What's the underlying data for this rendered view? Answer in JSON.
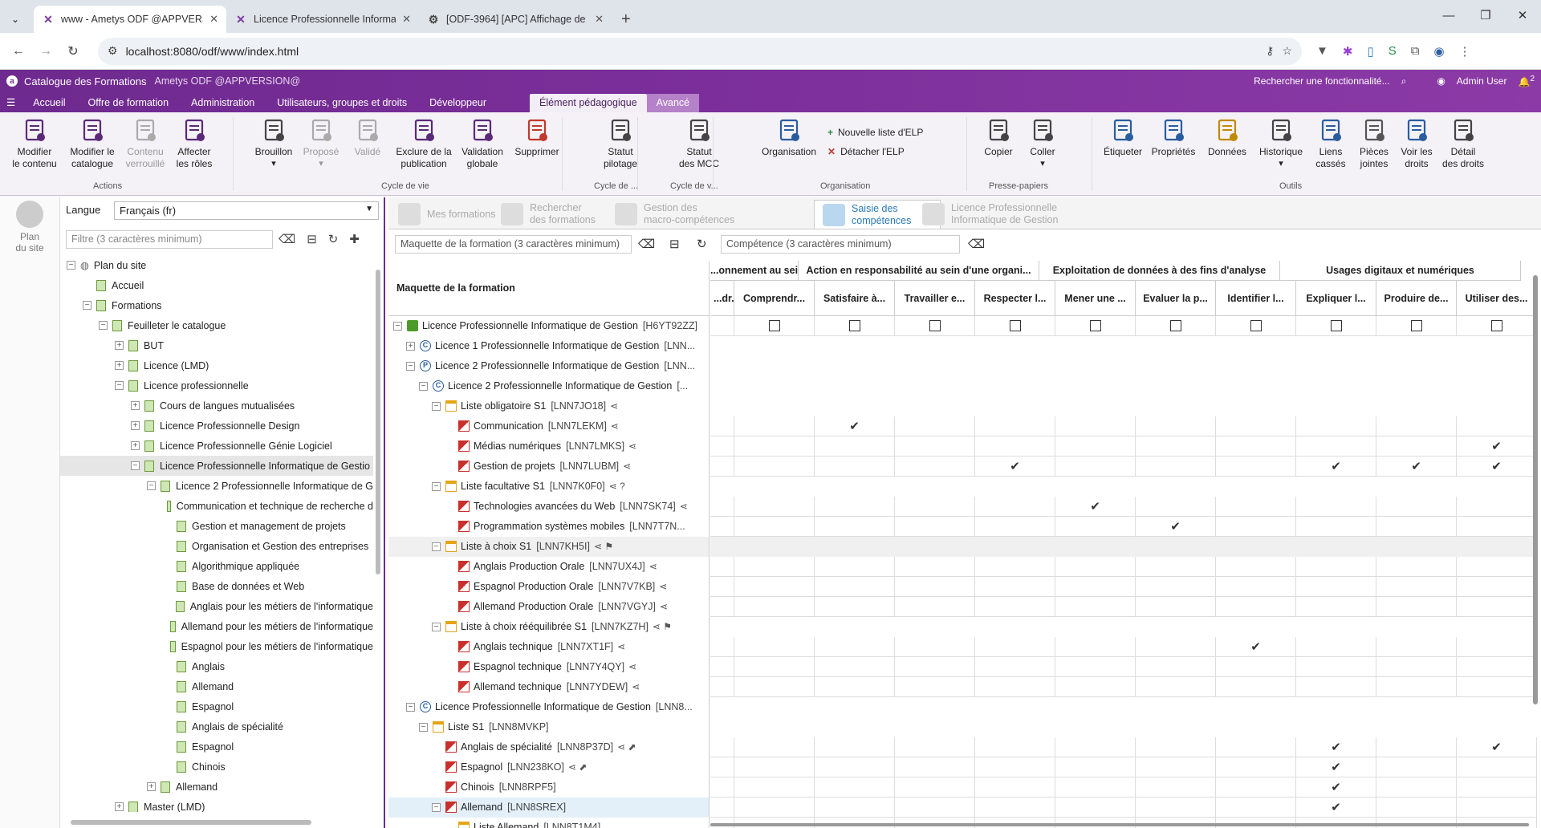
{
  "browser": {
    "tabs": [
      {
        "title": "www - Ametys ODF @APPVERSI",
        "icon": "ametys-icon"
      },
      {
        "title": "Licence Professionnelle Informa",
        "icon": "ametys-icon"
      },
      {
        "title": "[ODF-3964] [APC] Affichage de",
        "icon": "jira-icon"
      }
    ],
    "url": "localhost:8080/odf/www/index.html"
  },
  "app": {
    "title": "Catalogue des Formations",
    "version": "Ametys ODF @APPVERSION@",
    "search_placeholder": "Rechercher une fonctionnalité...",
    "user": "Admin User",
    "notif_count": "2",
    "menu": [
      "Accueil",
      "Offre de formation",
      "Administration",
      "Utilisateurs, groupes et droits",
      "Développeur"
    ],
    "context_tabs": [
      "Élément pédagogique",
      "Avancé"
    ]
  },
  "ribbon": {
    "buttons": [
      {
        "label1": "Modifier",
        "label2": "le contenu",
        "icon": "edit-icon"
      },
      {
        "label1": "Modifier le",
        "label2": "catalogue",
        "icon": "catalog-edit-icon"
      },
      {
        "label1": "Contenu",
        "label2": "verrouillé",
        "icon": "lock-icon"
      },
      {
        "label1": "Affecter",
        "label2": "les rôles",
        "icon": "roles-icon"
      },
      {
        "label1": "Brouillon",
        "label2": "",
        "icon": "draft-icon"
      },
      {
        "label1": "Proposé",
        "label2": "",
        "icon": "proposed-icon"
      },
      {
        "label1": "Validé",
        "label2": "",
        "icon": "validated-icon"
      },
      {
        "label1": "Exclure de la",
        "label2": "publication",
        "icon": "eye-icon"
      },
      {
        "label1": "Validation",
        "label2": "globale",
        "icon": "global-validation-icon"
      },
      {
        "label1": "Supprimer",
        "label2": "",
        "icon": "delete-icon"
      },
      {
        "label1": "Statut",
        "label2": "pilotage",
        "icon": "pilotage-icon"
      },
      {
        "label1": "Statut",
        "label2": "des MCC",
        "icon": "mcc-icon"
      },
      {
        "label1": "Organisation",
        "label2": "",
        "icon": "organisation-icon"
      },
      {
        "label1": "Copier",
        "label2": "",
        "icon": "copy-icon"
      },
      {
        "label1": "Coller",
        "label2": "",
        "icon": "paste-icon"
      },
      {
        "label1": "Étiqueter",
        "label2": "",
        "icon": "tag-icon"
      },
      {
        "label1": "Propriétés",
        "label2": "",
        "icon": "properties-icon"
      },
      {
        "label1": "Données",
        "label2": "",
        "icon": "data-icon"
      },
      {
        "label1": "Historique",
        "label2": "",
        "icon": "history-icon"
      },
      {
        "label1": "Liens",
        "label2": "cassés",
        "icon": "broken-links-icon"
      },
      {
        "label1": "Pièces",
        "label2": "jointes",
        "icon": "attachment-icon"
      },
      {
        "label1": "Voir les",
        "label2": "droits",
        "icon": "rights-icon"
      },
      {
        "label1": "Détail",
        "label2": "des droits",
        "icon": "rights-detail-icon"
      }
    ],
    "small": [
      "Nouvelle liste d'ELP",
      "Détacher l'ELP"
    ],
    "groups": [
      "Actions",
      "Cycle de vie",
      "Cycle de ...",
      "Cycle de v...",
      "Organisation",
      "Presse-papiers",
      "Outils"
    ]
  },
  "left": {
    "side_label1": "Plan",
    "side_label2": "du site",
    "lang_label": "Langue",
    "lang_value": "Français (fr)",
    "filter_placeholder": "Filtre (3 caractères minimum)",
    "tree": [
      {
        "t": "Plan du site",
        "d": 0,
        "e": "-",
        "k": "globe"
      },
      {
        "t": "Accueil",
        "d": 1,
        "e": "",
        "k": "page"
      },
      {
        "t": "Formations",
        "d": 1,
        "e": "-",
        "k": "page"
      },
      {
        "t": "Feuilleter le catalogue",
        "d": 2,
        "e": "-",
        "k": "page"
      },
      {
        "t": "BUT",
        "d": 3,
        "e": "+",
        "k": "page"
      },
      {
        "t": "Licence (LMD)",
        "d": 3,
        "e": "+",
        "k": "page"
      },
      {
        "t": "Licence professionnelle",
        "d": 3,
        "e": "-",
        "k": "page"
      },
      {
        "t": "Cours de langues mutualisées",
        "d": 4,
        "e": "+",
        "k": "page"
      },
      {
        "t": "Licence Professionnelle Design",
        "d": 4,
        "e": "+",
        "k": "page"
      },
      {
        "t": "Licence Professionnelle Génie Logiciel",
        "d": 4,
        "e": "+",
        "k": "page"
      },
      {
        "t": "Licence Professionnelle Informatique de Gestio",
        "d": 4,
        "e": "-",
        "k": "page",
        "sel": true
      },
      {
        "t": "Licence 2 Professionnelle Informatique de G",
        "d": 5,
        "e": "-",
        "k": "page"
      },
      {
        "t": "Communication et technique de recherche d",
        "d": 6,
        "e": "",
        "k": "page"
      },
      {
        "t": "Gestion et management de projets",
        "d": 6,
        "e": "",
        "k": "page"
      },
      {
        "t": "Organisation et Gestion des entreprises",
        "d": 6,
        "e": "",
        "k": "page"
      },
      {
        "t": "Algorithmique appliquée",
        "d": 6,
        "e": "",
        "k": "page"
      },
      {
        "t": "Base de données et Web",
        "d": 6,
        "e": "",
        "k": "page"
      },
      {
        "t": "Anglais pour les métiers de l'informatique",
        "d": 6,
        "e": "",
        "k": "page"
      },
      {
        "t": "Allemand pour les métiers de l'informatique",
        "d": 6,
        "e": "",
        "k": "page"
      },
      {
        "t": "Espagnol pour les métiers de l'informatique",
        "d": 6,
        "e": "",
        "k": "page"
      },
      {
        "t": "Anglais",
        "d": 6,
        "e": "",
        "k": "page"
      },
      {
        "t": "Allemand",
        "d": 6,
        "e": "",
        "k": "page"
      },
      {
        "t": "Espagnol",
        "d": 6,
        "e": "",
        "k": "page"
      },
      {
        "t": "Anglais de spécialité",
        "d": 6,
        "e": "",
        "k": "page"
      },
      {
        "t": "Espagnol",
        "d": 6,
        "e": "",
        "k": "page"
      },
      {
        "t": "Chinois",
        "d": 6,
        "e": "",
        "k": "page"
      },
      {
        "t": "Allemand",
        "d": 5,
        "e": "+",
        "k": "page"
      },
      {
        "t": "Master (LMD)",
        "d": 3,
        "e": "+",
        "k": "page"
      }
    ]
  },
  "right": {
    "tabs": [
      "Mes formations",
      "Rechercher des formations",
      "Gestion des macro-compétences",
      "Saisie des compétences",
      "Licence Professionnelle Informatique de Gestion"
    ],
    "tab_lines": [
      [
        "Mes formations"
      ],
      [
        "Rechercher",
        "des formations"
      ],
      [
        "Gestion des",
        "macro-compétences"
      ],
      [
        "Saisie des",
        "compétences"
      ],
      [
        "Licence Professionnelle",
        "Informatique de Gestion"
      ]
    ],
    "filter1_placeholder": "Maquette de la formation (3 caractères minimum)",
    "filter2_placeholder": "Compétence (3 caractères minimum)",
    "tree_header": "Maquette de la formation",
    "groups": [
      {
        "label": "...onnement au sein ...",
        "span": 2
      },
      {
        "label": "Action en responsabilité au sein d'une organi...",
        "span": 3
      },
      {
        "label": "Exploitation de données à des fins d'analyse",
        "span": 3
      },
      {
        "label": "Usages digitaux et numériques",
        "span": 3
      }
    ],
    "columns": [
      "...dr...",
      "Comprendr...",
      "Satisfaire à...",
      "Travailler e...",
      "Respecter l...",
      "Mener une ...",
      "Evaluer la p...",
      "Identifier l...",
      "Expliquer l...",
      "Produire de...",
      "Utiliser des..."
    ],
    "rows": [
      {
        "t": "Licence Professionnelle Informatique de Gestion",
        "c": "[H6YT92ZZ]",
        "d": 0,
        "e": "-",
        "k": "form",
        "cells": "cb"
      },
      {
        "t": "Licence 1 Professionnelle Informatique de Gestion",
        "c": "[LNN...",
        "d": 1,
        "e": "+",
        "k": "c",
        "kt": "C",
        "cells": ""
      },
      {
        "t": "Licence 2 Professionnelle Informatique de Gestion",
        "c": "[LNN...",
        "d": 1,
        "e": "-",
        "k": "c",
        "kt": "P",
        "cells": ""
      },
      {
        "t": "Licence 2 Professionnelle Informatique de Gestion",
        "c": "[...",
        "d": 2,
        "e": "-",
        "k": "c",
        "kt": "C",
        "cells": ""
      },
      {
        "t": "Liste obligatoire S1",
        "c": "[LNN7JO18]",
        "d": 3,
        "e": "-",
        "k": "list",
        "s": "⋖",
        "cells": ""
      },
      {
        "t": "Communication",
        "c": "[LNN7LEKM]",
        "d": 4,
        "e": "",
        "k": "ue",
        "s": "⋖",
        "cells": [
          2
        ]
      },
      {
        "t": "Médias numériques",
        "c": "[LNN7LMKS]",
        "d": 4,
        "e": "",
        "k": "ue",
        "s": "⋖",
        "cells": [
          10
        ]
      },
      {
        "t": "Gestion de projets",
        "c": "[LNN7LUBM]",
        "d": 4,
        "e": "",
        "k": "ue",
        "s": "⋖",
        "cells": [
          4,
          8,
          9,
          10
        ]
      },
      {
        "t": "Liste facultative S1",
        "c": "[LNN7K0F0]",
        "d": 3,
        "e": "-",
        "k": "list",
        "s": "⋖ ?",
        "cells": ""
      },
      {
        "t": "Technologies avancées du Web",
        "c": "[LNN7SK74]",
        "d": 4,
        "e": "",
        "k": "ue",
        "s": "⋖",
        "cells": [
          5
        ]
      },
      {
        "t": "Programmation systèmes mobiles",
        "c": "[LNN7T7N...",
        "d": 4,
        "e": "",
        "k": "ue",
        "s": "",
        "cells": [
          6
        ]
      },
      {
        "t": "Liste à choix S1",
        "c": "[LNN7KH5I]",
        "d": 3,
        "e": "-",
        "k": "list",
        "s": "⋖ ⚑",
        "cells": "hl"
      },
      {
        "t": "Anglais Production Orale",
        "c": "[LNN7UX4J]",
        "d": 4,
        "e": "",
        "k": "ue",
        "s": "⋖",
        "cells": []
      },
      {
        "t": "Espagnol Production Orale",
        "c": "[LNN7V7KB]",
        "d": 4,
        "e": "",
        "k": "ue",
        "s": "⋖",
        "cells": []
      },
      {
        "t": "Allemand Production Orale",
        "c": "[LNN7VGYJ]",
        "d": 4,
        "e": "",
        "k": "ue",
        "s": "⋖",
        "cells": []
      },
      {
        "t": "Liste à choix rééquilibrée S1",
        "c": "[LNN7KZ7H]",
        "d": 3,
        "e": "-",
        "k": "list",
        "s": "⋖ ⚑",
        "cells": ""
      },
      {
        "t": "Anglais technique",
        "c": "[LNN7XT1F]",
        "d": 4,
        "e": "",
        "k": "ue",
        "s": "⋖",
        "cells": [
          7
        ]
      },
      {
        "t": "Espagnol technique",
        "c": "[LNN7Y4QY]",
        "d": 4,
        "e": "",
        "k": "ue",
        "s": "⋖",
        "cells": []
      },
      {
        "t": "Allemand technique",
        "c": "[LNN7YDEW]",
        "d": 4,
        "e": "",
        "k": "ue",
        "s": "⋖",
        "cells": []
      },
      {
        "t": "Licence Professionnelle Informatique de Gestion",
        "c": "[LNN8...",
        "d": 1,
        "e": "-",
        "k": "c",
        "kt": "C",
        "cells": ""
      },
      {
        "t": "Liste S1",
        "c": "[LNN8MVKP]",
        "d": 2,
        "e": "-",
        "k": "list",
        "s": "",
        "cells": ""
      },
      {
        "t": "Anglais de spécialité",
        "c": "[LNN8P37D]",
        "d": 3,
        "e": "",
        "k": "ue",
        "s": "⋖ ⬈",
        "cells": [
          8,
          10
        ]
      },
      {
        "t": "Espagnol",
        "c": "[LNN238KO]",
        "d": 3,
        "e": "",
        "k": "ue",
        "s": "⋖ ⬈",
        "cells": [
          8
        ]
      },
      {
        "t": "Chinois",
        "c": "[LNN8RPF5]",
        "d": 3,
        "e": "",
        "k": "ue",
        "s": "",
        "cells": [
          8
        ]
      },
      {
        "t": "Allemand",
        "c": "[LNN8SREX]",
        "d": 3,
        "e": "-",
        "k": "ue",
        "s": "",
        "cells": [
          8
        ],
        "sel": true
      },
      {
        "t": "Liste Allemand",
        "c": "[LNN8T1M4]",
        "d": 4,
        "e": "",
        "k": "list",
        "s": "",
        "cells": []
      }
    ]
  },
  "colors": {
    "brand": "#7a2e99",
    "accent": "#2a7ab8"
  }
}
